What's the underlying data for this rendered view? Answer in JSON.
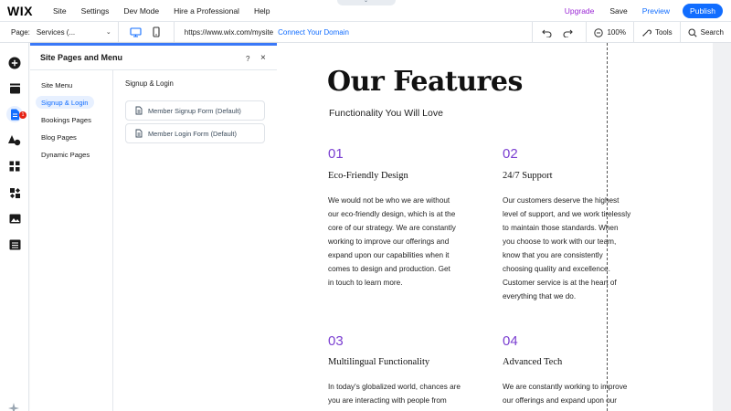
{
  "topbar": {
    "logo": "WIX",
    "menu": [
      "Site",
      "Settings",
      "Dev Mode",
      "Hire a Professional",
      "Help"
    ],
    "upgrade": "Upgrade",
    "save": "Save",
    "preview": "Preview",
    "publish": "Publish"
  },
  "toolbar": {
    "page_label": "Page:",
    "page_value": "Services (...",
    "url": "https://www.wix.com/mysite",
    "connect": "Connect Your Domain",
    "zoom": "100%",
    "tools": "Tools",
    "search": "Search"
  },
  "rail": {
    "badge": "1",
    "icons": [
      "add-icon",
      "sections-icon",
      "pages-icon",
      "design-icon",
      "apps-icon",
      "business-icon",
      "media-icon",
      "cms-icon",
      "ai-sparkle-icon"
    ]
  },
  "panel": {
    "title": "Site Pages and Menu",
    "help": "?",
    "close": "×",
    "nav": [
      "Site Menu",
      "Signup & Login",
      "Bookings Pages",
      "Blog Pages",
      "Dynamic Pages"
    ],
    "active_nav": "Signup & Login",
    "section_title": "Signup & Login",
    "forms": [
      "Member Signup Form (Default)",
      "Member Login Form (Default)"
    ]
  },
  "canvas": {
    "heading": "Our Features",
    "subheading": "Functionality You Will Love",
    "features": [
      {
        "num": "01",
        "title": "Eco-Friendly Design",
        "lines": [
          "We would not be who we are without",
          "our eco-friendly design, which is at the",
          "core of our strategy. We are constantly",
          "working to improve our offerings and",
          "expand upon our capabilities when it",
          "comes to design and production. Get",
          "in touch to learn more."
        ]
      },
      {
        "num": "02",
        "title": "24/7 Support",
        "lines": [
          "Our customers deserve the highest",
          "level of support, and we work tirelessly",
          "to maintain those standards. When",
          "you choose to work with our team,",
          "know that you are consistently",
          "choosing quality and excellence.",
          "Customer service is at the heart of",
          "everything that we do."
        ]
      },
      {
        "num": "03",
        "title": "Multilingual Functionality",
        "lines": [
          "In today's globalized world, chances are",
          "you are interacting with people from"
        ]
      },
      {
        "num": "04",
        "title": "Advanced Tech",
        "lines": [
          "We are constantly working to improve",
          "our offerings and expand upon our"
        ]
      }
    ]
  },
  "colors": {
    "accent": "#116dff",
    "upgrade": "#9a27d5",
    "feature_number": "#7b3fd1",
    "badge": "#e62214"
  }
}
